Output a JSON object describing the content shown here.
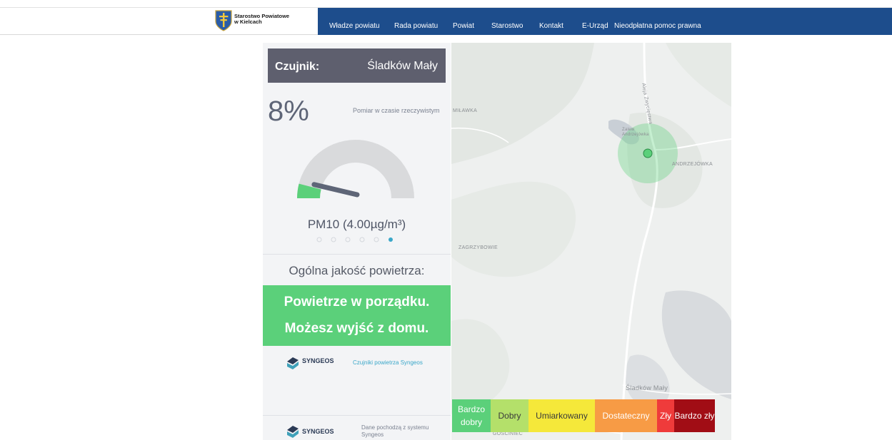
{
  "header": {
    "logo_text_line1": "Starostwo Powiatowe",
    "logo_text_line2": "w Kielcach",
    "nav": [
      {
        "label": "Władze powiatu"
      },
      {
        "label": "Rada powiatu"
      },
      {
        "label": "Powiat"
      },
      {
        "label": "Starostwo"
      },
      {
        "label": "Kontakt"
      },
      {
        "label": "E-Urząd"
      },
      {
        "label": "Nieodpłatna pomoc prawna"
      }
    ]
  },
  "sensor": {
    "label": "Czujnik:",
    "name": "Śladków Mały",
    "percent": "8%",
    "realtime_label": "Pomiar w czasie rzeczywistym",
    "gauge_fraction": 0.08,
    "pollutant": "PM10 (4.00µg/m³)",
    "carousel_count": 6,
    "carousel_active": 5
  },
  "quality": {
    "title": "Ogólna jakość powietrza:",
    "line1": "Powietrze w porządku.",
    "line2": "Możesz wyjść z domu.",
    "color": "#5bd07a"
  },
  "footer": {
    "syngeos_brand": "SYNGEOS",
    "syngeos_link": "Czujniki powietrza Syngeos",
    "source_text": "Dane pochodzą z systemu Syngeos"
  },
  "map": {
    "labels": {
      "milawka": "MIŁAWKA",
      "aleja": "Aleja Zwycięstwa",
      "andrzejowka": "ANDRZEJÓWKA",
      "zagrzybowie": "ZAGRZYBOWIE",
      "sladkow": "Śladków Mały",
      "gosciniec": "GOŚCINIEC",
      "zalew": "Zalew Andrzejówka"
    },
    "marker_color": "#5bd07a"
  },
  "legend": [
    {
      "label": "Bardzo dobry",
      "color": "#5bd07a"
    },
    {
      "label": "Dobry",
      "color": "#b4e06a"
    },
    {
      "label": "Umiarkowany",
      "color": "#f5e83a"
    },
    {
      "label": "Dostateczny",
      "color": "#f79b45"
    },
    {
      "label": "Zły",
      "color": "#ef3b3b"
    },
    {
      "label": "Bardzo zły",
      "color": "#a10d15"
    }
  ]
}
